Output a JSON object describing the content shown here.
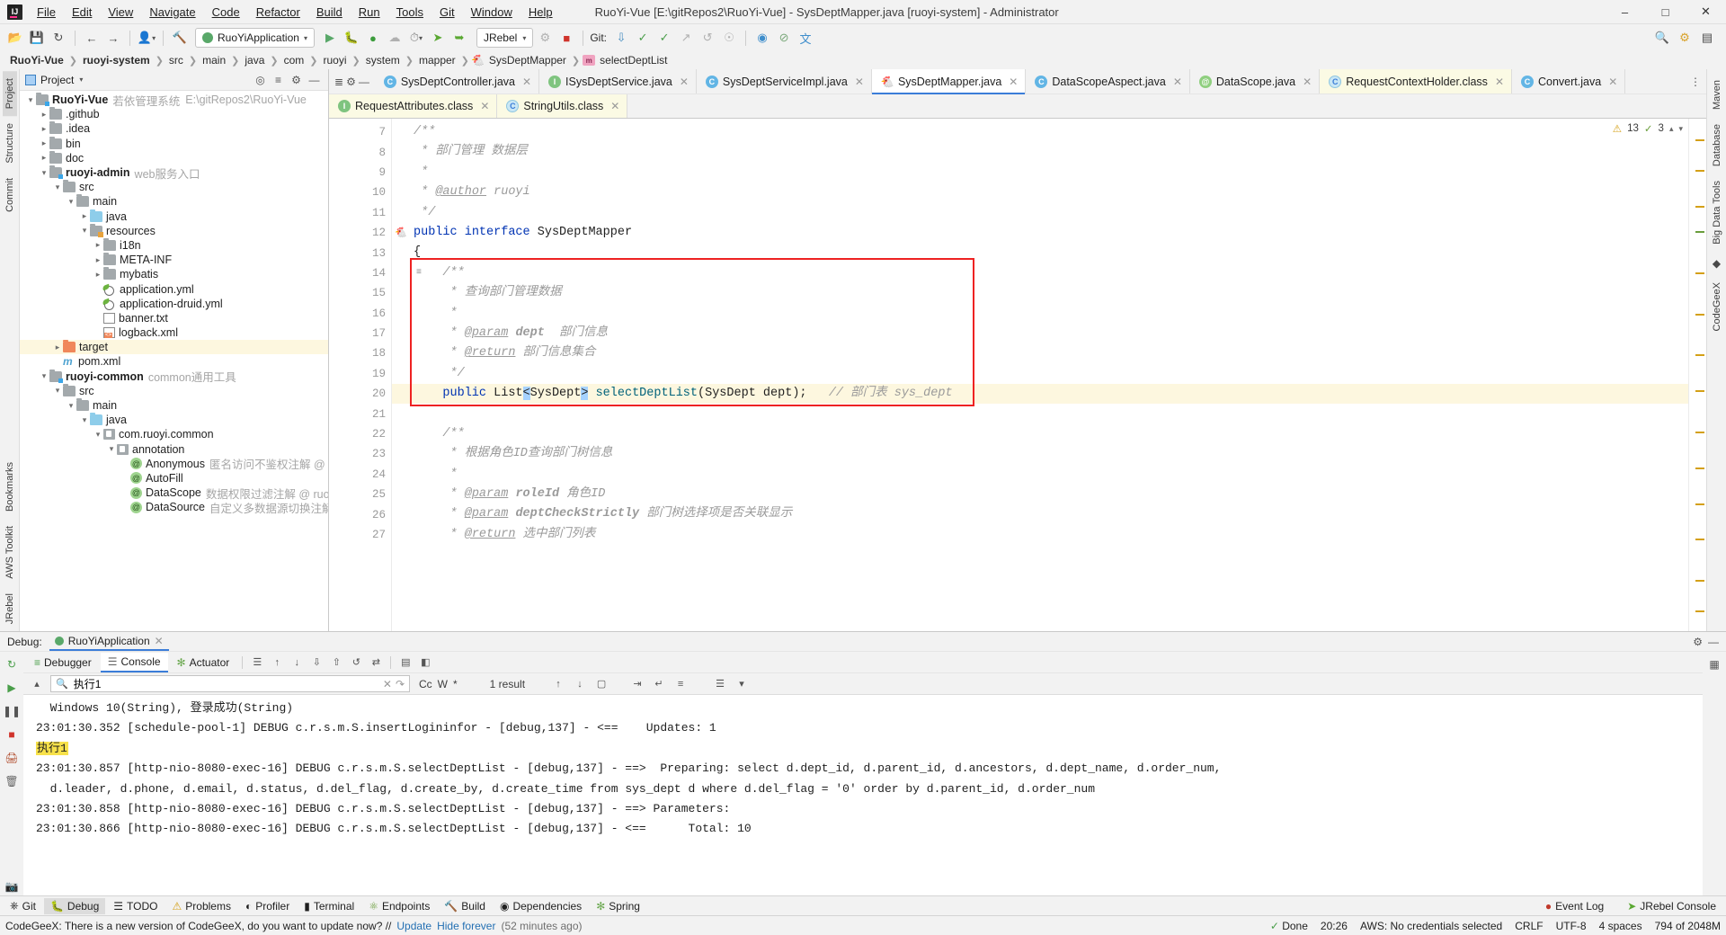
{
  "window": {
    "title": "RuoYi-Vue [E:\\gitRepos2\\RuoYi-Vue] - SysDeptMapper.java [ruoyi-system] - Administrator",
    "minimize": "─",
    "maximize": "☐",
    "close": "✕"
  },
  "menu": [
    "File",
    "Edit",
    "View",
    "Navigate",
    "Code",
    "Refactor",
    "Build",
    "Run",
    "Tools",
    "Git",
    "Window",
    "Help"
  ],
  "toolbar": {
    "run_config": "RuoYiApplication",
    "jrebel": "JRebel",
    "git_label": "Git:",
    "icons": [
      "open-folder-icon",
      "save-all-icon",
      "sync-icon",
      "back-icon",
      "forward-icon",
      "user-icon",
      "build-hammer-icon",
      "run-icon",
      "debug-icon",
      "run-coverage-icon",
      "stop-icon",
      "profiler-icon",
      "jrebel-run-icon",
      "jrebel-debug-icon",
      "git-update-icon",
      "git-commit-icon",
      "git-push-icon",
      "git-history-icon",
      "git-rollback-icon",
      "search-everywhere-icon",
      "settings-icon",
      "translate-icon",
      "layout-icon"
    ]
  },
  "breadcrumb": [
    {
      "label": "RuoYi-Vue",
      "bold": true
    },
    {
      "label": "ruoyi-system",
      "bold": true
    },
    {
      "label": "src",
      "bold": false
    },
    {
      "label": "main",
      "bold": false
    },
    {
      "label": "java",
      "bold": false
    },
    {
      "label": "com",
      "bold": false
    },
    {
      "label": "ruoyi",
      "bold": false
    },
    {
      "label": "system",
      "bold": false
    },
    {
      "label": "mapper",
      "bold": false
    },
    {
      "label": "SysDeptMapper",
      "bold": false,
      "icon": "interface-icon"
    },
    {
      "label": "selectDeptList",
      "bold": false,
      "icon": "method-icon"
    }
  ],
  "left_rail": [
    "Project",
    "Structure",
    "Commit"
  ],
  "left_rail_bottom": [
    "Bookmarks",
    "AWS Toolkit",
    "JRebel"
  ],
  "right_rail": [
    "Maven",
    "Database",
    "Big Data Tools",
    "CodeGeeX"
  ],
  "project_panel": {
    "title": "Project",
    "actions": [
      "locate-icon",
      "collapse-all-icon",
      "settings-icon",
      "hide-icon"
    ],
    "tree": [
      {
        "indent": 0,
        "twist": "v",
        "icon": "module-folder",
        "label": "RuoYi-Vue",
        "bold": true,
        "sub": "若依管理系统",
        "path": "E:\\gitRepos2\\RuoYi-Vue"
      },
      {
        "indent": 1,
        "twist": ">",
        "icon": "folder",
        "label": ".github"
      },
      {
        "indent": 1,
        "twist": ">",
        "icon": "folder",
        "label": ".idea"
      },
      {
        "indent": 1,
        "twist": ">",
        "icon": "folder",
        "label": "bin"
      },
      {
        "indent": 1,
        "twist": ">",
        "icon": "folder",
        "label": "doc"
      },
      {
        "indent": 1,
        "twist": "v",
        "icon": "module-folder",
        "label": "ruoyi-admin",
        "bold": true,
        "sub": "web服务入口"
      },
      {
        "indent": 2,
        "twist": "v",
        "icon": "folder",
        "label": "src"
      },
      {
        "indent": 3,
        "twist": "v",
        "icon": "folder",
        "label": "main"
      },
      {
        "indent": 4,
        "twist": ">",
        "icon": "folder-blue",
        "label": "java"
      },
      {
        "indent": 4,
        "twist": "v",
        "icon": "folder-res",
        "label": "resources"
      },
      {
        "indent": 5,
        "twist": ">",
        "icon": "folder",
        "label": "i18n"
      },
      {
        "indent": 5,
        "twist": ">",
        "icon": "folder",
        "label": "META-INF"
      },
      {
        "indent": 5,
        "twist": ">",
        "icon": "folder",
        "label": "mybatis"
      },
      {
        "indent": 5,
        "twist": "",
        "icon": "yml",
        "label": "application.yml"
      },
      {
        "indent": 5,
        "twist": "",
        "icon": "yml",
        "label": "application-druid.yml"
      },
      {
        "indent": 5,
        "twist": "",
        "icon": "txt",
        "label": "banner.txt"
      },
      {
        "indent": 5,
        "twist": "",
        "icon": "xml",
        "label": "logback.xml"
      },
      {
        "indent": 2,
        "twist": ">",
        "icon": "folder-orange",
        "label": "target",
        "highlight": true
      },
      {
        "indent": 2,
        "twist": "",
        "icon": "maven",
        "label": "pom.xml"
      },
      {
        "indent": 1,
        "twist": "v",
        "icon": "module-folder",
        "label": "ruoyi-common",
        "bold": true,
        "sub": "common通用工具"
      },
      {
        "indent": 2,
        "twist": "v",
        "icon": "folder",
        "label": "src"
      },
      {
        "indent": 3,
        "twist": "v",
        "icon": "folder",
        "label": "main"
      },
      {
        "indent": 4,
        "twist": "v",
        "icon": "folder-blue",
        "label": "java"
      },
      {
        "indent": 5,
        "twist": "v",
        "icon": "package",
        "label": "com.ruoyi.common"
      },
      {
        "indent": 6,
        "twist": "v",
        "icon": "package",
        "label": "annotation"
      },
      {
        "indent": 7,
        "twist": "",
        "icon": "annotation",
        "label": "Anonymous",
        "sub": "匿名访问不鉴权注解 @ ruoyi"
      },
      {
        "indent": 7,
        "twist": "",
        "icon": "annotation",
        "label": "AutoFill"
      },
      {
        "indent": 7,
        "twist": "",
        "icon": "annotation",
        "label": "DataScope",
        "sub": "数据权限过滤注解 @ ruoyi"
      },
      {
        "indent": 7,
        "twist": "",
        "icon": "annotation",
        "label": "DataSource",
        "sub": "自定义多数据源切换注解 @ ruoyi"
      }
    ]
  },
  "editor_tabs_row1": [
    {
      "label": "SysDeptController.java",
      "icon": "class-icon",
      "active": false,
      "style": "normal"
    },
    {
      "label": "ISysDeptService.java",
      "icon": "interface-icon",
      "active": false,
      "style": "normal"
    },
    {
      "label": "SysDeptServiceImpl.java",
      "icon": "class-icon",
      "active": false,
      "style": "normal"
    },
    {
      "label": "SysDeptMapper.java",
      "icon": "mybatis-icon",
      "active": true,
      "style": "normal"
    },
    {
      "label": "DataScopeAspect.java",
      "icon": "class-icon",
      "active": false,
      "style": "normal"
    },
    {
      "label": "DataScope.java",
      "icon": "annotation-icon",
      "active": false,
      "style": "normal"
    },
    {
      "label": "RequestContextHolder.class",
      "icon": "classfile-icon",
      "active": false,
      "style": "yellow"
    },
    {
      "label": "Convert.java",
      "icon": "class-icon",
      "active": false,
      "style": "normal"
    }
  ],
  "editor_tabs_row2": [
    {
      "label": "RequestAttributes.class",
      "icon": "interfacefile-icon",
      "active": false,
      "style": "yellow"
    },
    {
      "label": "StringUtils.class",
      "icon": "classfile-icon",
      "active": false,
      "style": "yellow"
    }
  ],
  "inspection": {
    "warnings": "13",
    "weak": "3"
  },
  "code": {
    "first_line": 7,
    "lines": [
      {
        "n": 7,
        "html": "<span class='cmt'>/**</span>",
        "fold": "minus"
      },
      {
        "n": 8,
        "html": "<span class='cmt'> * 部门管理 数据层</span>"
      },
      {
        "n": 9,
        "html": "<span class='cmt'> *</span>"
      },
      {
        "n": 10,
        "html": "<span class='cmt'> * </span><span class='tagdoc'>@author</span><span class='cmt'> ruoyi</span>"
      },
      {
        "n": 11,
        "html": "<span class='cmt'> */</span>",
        "fold": "end"
      },
      {
        "n": 12,
        "html": "<span class='kw'>public</span> <span class='kw'>interface</span> SysDeptMapper",
        "bean": true
      },
      {
        "n": 13,
        "html": "{"
      },
      {
        "n": 14,
        "html": "    <span class='cmt'>/**</span>",
        "fold": "minus",
        "ann": true
      },
      {
        "n": 15,
        "html": "    <span class='cmt'> * 查询部门管理数据</span>"
      },
      {
        "n": 16,
        "html": "    <span class='cmt'> *</span>"
      },
      {
        "n": 17,
        "html": "    <span class='cmt'> * </span><span class='tagdoc'>@param</span><span class='cmt'> </span><b class='cmt'>dept</b><span class='cmt'>  部门信息</span>"
      },
      {
        "n": 18,
        "html": "    <span class='cmt'> * </span><span class='tagdoc'>@return</span><span class='cmt'> 部门信息集合</span>"
      },
      {
        "n": 19,
        "html": "    <span class='cmt'> */</span>"
      },
      {
        "n": 20,
        "html": "    <span class='kw'>public</span> List<span class='sel'>&lt;</span>SysDept<span class='sel'>&gt;</span> <span class='mname'>selectDeptList</span>(SysDept dept);   <span class='cmt'>// 部门表 sys_dept</span>",
        "hl": true,
        "bean": true
      },
      {
        "n": 21,
        "html": ""
      },
      {
        "n": 22,
        "html": "    <span class='cmt'>/**</span>",
        "fold": "minus"
      },
      {
        "n": 23,
        "html": "    <span class='cmt'> * 根据角色ID查询部门树信息</span>"
      },
      {
        "n": 24,
        "html": "    <span class='cmt'> *</span>"
      },
      {
        "n": 25,
        "html": "    <span class='cmt'> * </span><span class='tagdoc'>@param</span><span class='cmt'> </span><b class='cmt'>roleId</b><span class='cmt'> 角色ID</span>"
      },
      {
        "n": 26,
        "html": "    <span class='cmt'> * </span><span class='tagdoc'>@param</span><span class='cmt'> </span><b class='cmt'>deptCheckStrictly</b><span class='cmt'> 部门树选择项是否关联显示</span>"
      },
      {
        "n": 27,
        "html": "    <span class='cmt'> * </span><span class='tagdoc'>@return</span><span class='cmt'> 选中部门列表</span>"
      }
    ]
  },
  "debug": {
    "panel_label": "Debug:",
    "session_name": "RuoYiApplication",
    "tabs": [
      {
        "label": "Debugger",
        "icon": "debugger-icon",
        "active": false
      },
      {
        "label": "Console",
        "icon": "console-icon",
        "active": true
      },
      {
        "label": "Actuator",
        "icon": "actuator-icon",
        "active": false
      }
    ],
    "search": {
      "value": "执行1",
      "placeholder": "",
      "result_count": "1 result",
      "options": [
        "Cc",
        "W",
        "*"
      ]
    },
    "console_lines": [
      {
        "text": "  Windows 10(String), 登录成功(String)"
      },
      {
        "text": "23:01:30.352 [schedule-pool-1] DEBUG c.r.s.m.S.insertLogininfor - [debug,137] - <==    Updates: 1"
      },
      {
        "text": "执行1",
        "highlight": true
      },
      {
        "text": "23:01:30.857 [http-nio-8080-exec-16] DEBUG c.r.s.m.S.selectDeptList - [debug,137] - ==>  Preparing: select d.dept_id, d.parent_id, d.ancestors, d.dept_name, d.order_num,"
      },
      {
        "text": "  d.leader, d.phone, d.email, d.status, d.del_flag, d.create_by, d.create_time from sys_dept d where d.del_flag = '0' order by d.parent_id, d.order_num"
      },
      {
        "text": "23:01:30.858 [http-nio-8080-exec-16] DEBUG c.r.s.m.S.selectDeptList - [debug,137] - ==> Parameters:"
      },
      {
        "text": "23:01:30.866 [http-nio-8080-exec-16] DEBUG c.r.s.m.S.selectDeptList - [debug,137] - <==      Total: 10"
      }
    ]
  },
  "bottom_bar": {
    "left": [
      {
        "label": "Git",
        "icon": "git-icon",
        "active": false
      },
      {
        "label": "Debug",
        "icon": "debug-icon",
        "active": true
      },
      {
        "label": "TODO",
        "icon": "todo-icon",
        "active": false
      },
      {
        "label": "Problems",
        "icon": "problems-icon",
        "active": false
      },
      {
        "label": "Profiler",
        "icon": "profiler-icon",
        "active": false
      },
      {
        "label": "Terminal",
        "icon": "terminal-icon",
        "active": false
      },
      {
        "label": "Endpoints",
        "icon": "endpoints-icon",
        "active": false
      },
      {
        "label": "Build",
        "icon": "build-icon",
        "active": false
      },
      {
        "label": "Dependencies",
        "icon": "dependencies-icon",
        "active": false
      },
      {
        "label": "Spring",
        "icon": "spring-icon",
        "active": false
      }
    ],
    "right": [
      {
        "label": "Event Log",
        "icon": "event-log-icon"
      },
      {
        "label": "JRebel Console",
        "icon": "jrebel-icon"
      }
    ]
  },
  "notification": {
    "message": "CodeGeeX: There is a new version of CodeGeeX, do you want to update now? //",
    "link": "Update",
    "hide_link": "Hide forever",
    "age": "(52 minutes ago)",
    "status_done": "Done",
    "time": "20:26",
    "aws": "AWS: No credentials selected",
    "line_sep": "CRLF",
    "encoding": "UTF-8",
    "indent": "4 spaces",
    "memory": "794 of 2048M"
  }
}
